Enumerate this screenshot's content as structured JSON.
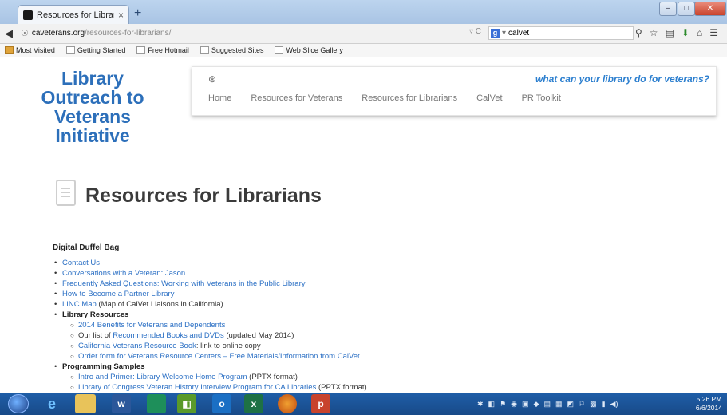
{
  "browser": {
    "tab_title": "Resources for Librarians | Libra...",
    "tab_close": "×",
    "new_tab": "+",
    "url_domain": "caveterans.org",
    "url_path": "/resources-for-librarians/",
    "search_query": "calvet",
    "bookmarks": [
      "Most Visited",
      "Getting Started",
      "Free Hotmail",
      "Suggested Sites",
      "Web Slice Gallery"
    ]
  },
  "site": {
    "logo_lines": [
      "Library",
      "Outreach to",
      "Veterans",
      "Initiative"
    ],
    "tagline": "what can your library do for veterans?",
    "menu": [
      "Home",
      "Resources for Veterans",
      "Resources for Librarians",
      "CalVet",
      "PR Toolkit"
    ]
  },
  "page": {
    "title": "Resources for Librarians",
    "section": "Digital Duffel Bag",
    "items": [
      {
        "link": "Contact Us",
        "text": ""
      },
      {
        "link": "Conversations with a Veteran: Jason",
        "text": ""
      },
      {
        "link": "Frequently Asked Questions: Working with Veterans in the Public Library",
        "text": ""
      },
      {
        "link": "How to Become a Partner Library",
        "text": ""
      },
      {
        "link": "LINC Map",
        "text": " (Map of CalVet Liaisons in California)"
      },
      {
        "heading": "Library Resources"
      },
      {
        "sub_link": "2014 Benefits for Veterans and Dependents",
        "sub_pre": "",
        "sub_text": ""
      },
      {
        "sub_pre": "Our list of ",
        "sub_link": "Recommended Books and DVDs",
        "sub_text": " (updated May 2014)"
      },
      {
        "sub_link": "California Veterans Resource Book",
        "sub_pre": "",
        "sub_text": ": link to online copy"
      },
      {
        "sub_link": "Order form for Veterans Resource Centers – Free Materials/Information from CalVet",
        "sub_pre": "",
        "sub_text": ""
      },
      {
        "heading": "Programming Samples"
      },
      {
        "sub_link": "Intro and Primer: Library Welcome Home Program",
        "sub_pre": "",
        "sub_text": " (PPTX format)"
      },
      {
        "sub_link": "Library of Congress Veteran History Interview Program for CA Libraries",
        "sub_pre": "",
        "sub_text": " (PPTX format)"
      }
    ]
  },
  "taskbar": {
    "time": "5:26 PM",
    "date": "6/6/2014",
    "apps": [
      "internet-explorer",
      "file-explorer",
      "word",
      "publisher",
      "excel-green",
      "outlook",
      "excel",
      "firefox",
      "powerpoint"
    ]
  },
  "colors": {
    "link": "#2a6fc4",
    "logo": "#2c6fba",
    "tagline": "#2c7fcf",
    "taskbar": "#1f5ea8"
  }
}
